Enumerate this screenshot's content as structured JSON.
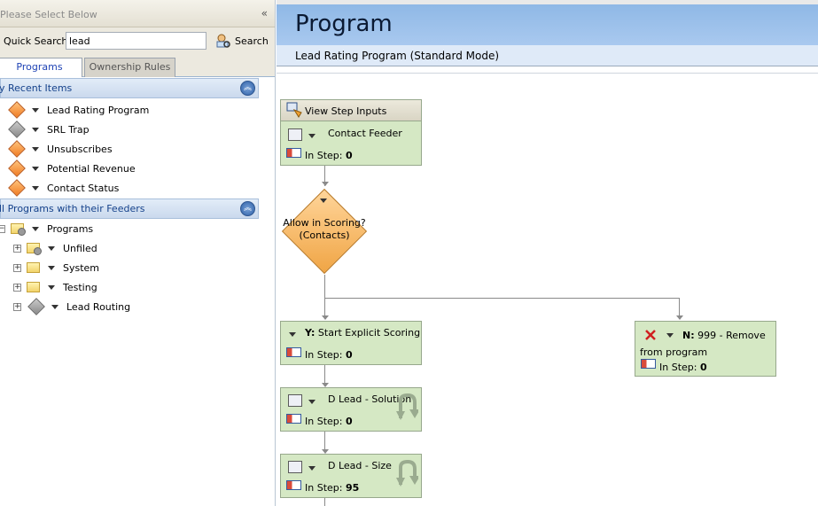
{
  "left_panel": {
    "header": "Please Select Below",
    "collapse_icon": "«",
    "quick_search": {
      "label": "Quick Search",
      "value": "lead",
      "button": "Search"
    },
    "tabs": [
      "Programs",
      "Ownership Rules"
    ],
    "recent_section": "y Recent Items",
    "recent_items": [
      {
        "label": "Lead Rating Program",
        "icon": "diamond-orange"
      },
      {
        "label": "SRL Trap",
        "icon": "diamond-gray"
      },
      {
        "label": "Unsubscribes",
        "icon": "diamond-orange"
      },
      {
        "label": "Potential Revenue",
        "icon": "diamond-orange"
      },
      {
        "label": "Contact Status",
        "icon": "diamond-orange"
      }
    ],
    "feeders_section": "ll Programs with their Feeders",
    "tree": {
      "root": "Programs",
      "children": [
        "Unfiled",
        "System",
        "Testing",
        "Lead Routing"
      ]
    }
  },
  "program": {
    "title": "Program",
    "subtitle": "Lead Rating Program (Standard Mode)",
    "view_inputs": "View Step Inputs",
    "in_step_label": "In Step:",
    "nodes": {
      "contact_feeder": {
        "name": "Contact Feeder",
        "count": "0"
      },
      "decision": {
        "label": "Allow in Scoring? (Contacts)"
      },
      "start_scoring": {
        "prefix": "Y:",
        "name": "Start Explicit Scoring",
        "count": "0"
      },
      "remove": {
        "prefix": "N:",
        "name": "999 - Remove from program",
        "count": "0"
      },
      "d_lead_solution": {
        "name": "D Lead - Solution",
        "count": "0"
      },
      "d_lead_size": {
        "name": "D Lead - Size",
        "count": "95"
      }
    }
  },
  "colors": {
    "node_fill": "#d5e8c4",
    "decision_fill": "#f7b25a",
    "title_bar": "#a9c9ef"
  }
}
